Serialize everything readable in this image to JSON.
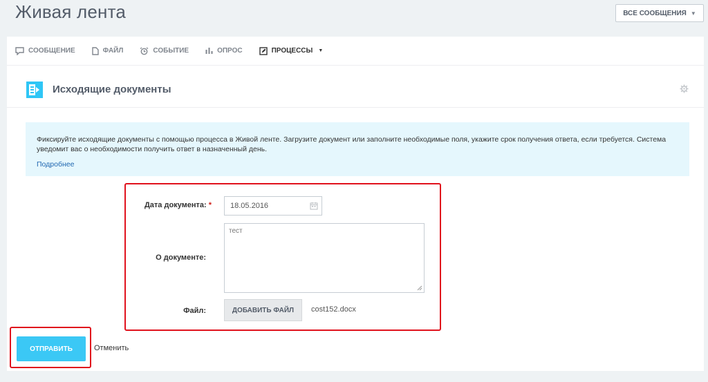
{
  "page": {
    "title": "Живая лента",
    "filter_label": "ВСЕ СООБЩЕНИЯ"
  },
  "tabs": [
    {
      "label": "СООБЩЕНИЕ",
      "icon": "message-icon"
    },
    {
      "label": "ФАЙЛ",
      "icon": "file-icon"
    },
    {
      "label": "СОБЫТИЕ",
      "icon": "alarm-clock-icon"
    },
    {
      "label": "ОПРОС",
      "icon": "poll-icon"
    },
    {
      "label": "ПРОЦЕССЫ",
      "icon": "process-edit-icon",
      "active": true
    }
  ],
  "process": {
    "title": "Исходящие документы",
    "logo_icon": "outgoing-document-icon",
    "settings_icon": "gear-icon"
  },
  "info": {
    "text": "Фиксируйте исходящие документы с помощью процесса в Живой ленте. Загрузите документ или заполните необходимые поля, укажите срок получения ответа, если требуется. Система уведомит вас о необходимости получить ответ в назначенный день.",
    "link": "Подробнее"
  },
  "form": {
    "date_label": "Дата документа:",
    "date_required_mark": "*",
    "date_value": "18.05.2016",
    "about_label": "О документе:",
    "about_value": "тест",
    "file_label": "Файл:",
    "file_button": "ДОБАВИТЬ ФАЙЛ",
    "file_name": "cost152.docx"
  },
  "actions": {
    "submit": "ОТПРАВИТЬ",
    "cancel": "Отменить"
  },
  "colors": {
    "accent": "#3bc8f5",
    "highlight": "#e0111c",
    "info_bg": "#e5f7fd",
    "link": "#2067b0"
  }
}
